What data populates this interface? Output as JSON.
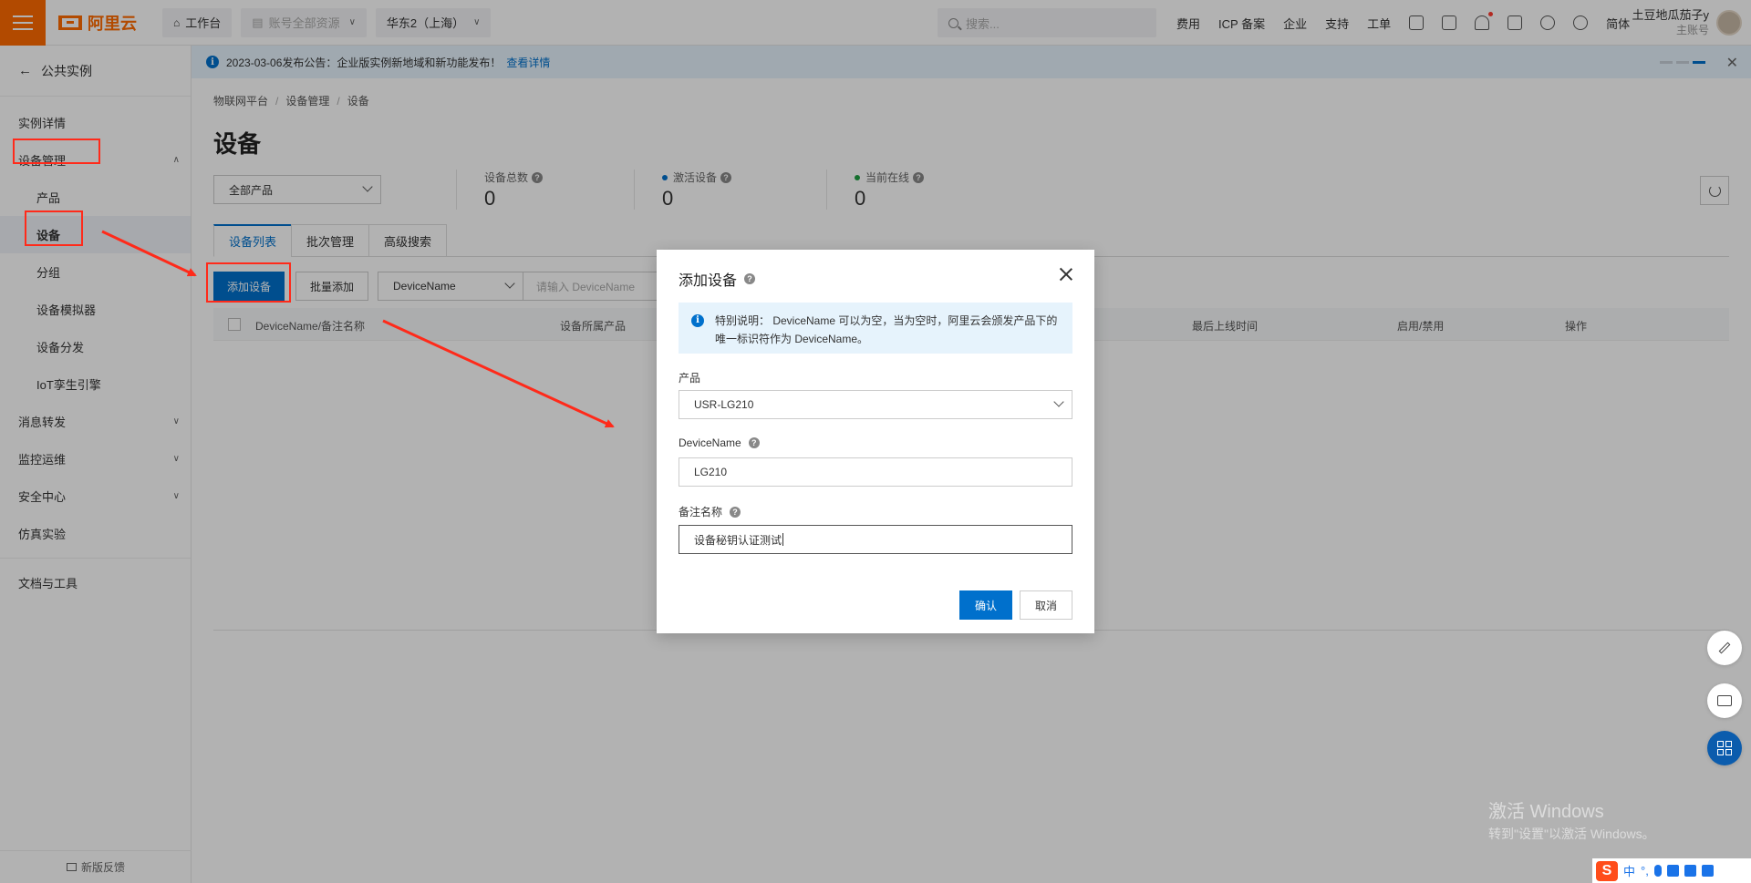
{
  "topbar": {
    "logo_text": "阿里云",
    "workbench": "工作台",
    "resource_scope": "账号全部资源",
    "region": "华东2（上海）",
    "search_placeholder": "搜索...",
    "links": [
      "费用",
      "ICP 备案",
      "企业",
      "支持",
      "工单"
    ],
    "lang": "简体",
    "user_name": "土豆地瓜茄子y",
    "user_role": "主账号"
  },
  "sidebar": {
    "back_label": "公共实例",
    "items": {
      "instance_detail": "实例详情",
      "device_mgmt": "设备管理",
      "product": "产品",
      "device": "设备",
      "group": "分组",
      "simulator": "设备模拟器",
      "distribution": "设备分发",
      "twin": "IoT孪生引擎",
      "message": "消息转发",
      "monitor": "监控运维",
      "security": "安全中心",
      "sim_lab": "仿真实验",
      "docs": "文档与工具"
    },
    "feedback": "新版反馈"
  },
  "announcement": {
    "text": "2023-03-06发布公告：企业版实例新地域和新功能发布！",
    "link": "查看详情"
  },
  "main": {
    "breadcrumb": [
      "物联网平台",
      "设备管理",
      "设备"
    ],
    "title": "设备",
    "product_filter": "全部产品",
    "stats": {
      "total_label": "设备总数",
      "total_value": "0",
      "active_label": "激活设备",
      "active_value": "0",
      "online_label": "当前在线",
      "online_value": "0"
    },
    "tabs": [
      "设备列表",
      "批次管理",
      "高级搜索"
    ],
    "add_button": "添加设备",
    "batch_button": "批量添加",
    "search_field": "DeviceName",
    "search_placeholder": "请输入 DeviceName",
    "columns": {
      "name": "DeviceName/备注名称",
      "product": "设备所属产品",
      "last_online": "最后上线时间",
      "enable": "启用/禁用",
      "action": "操作"
    }
  },
  "modal": {
    "title": "添加设备",
    "notice_line1": "特别说明： DeviceName 可以为空，当为空时，阿里云会颁发产品下的",
    "notice_line2": "唯一标识符作为 DeviceName。",
    "product_label": "产品",
    "product_value": "USR-LG210",
    "device_name_label": "DeviceName",
    "device_name_value": "LG210",
    "remark_label": "备注名称",
    "remark_value": "设备秘钥认证测试",
    "confirm": "确认",
    "cancel": "取消"
  },
  "watermark": {
    "line1": "激活 Windows",
    "line2": "转到\"设置\"以激活 Windows。"
  },
  "ime": {
    "logo": "S",
    "mode": "中"
  },
  "colors": {
    "brand_orange": "#ff6a00",
    "primary_blue": "#0070cc",
    "annotation_red": "#ff2a1a"
  }
}
